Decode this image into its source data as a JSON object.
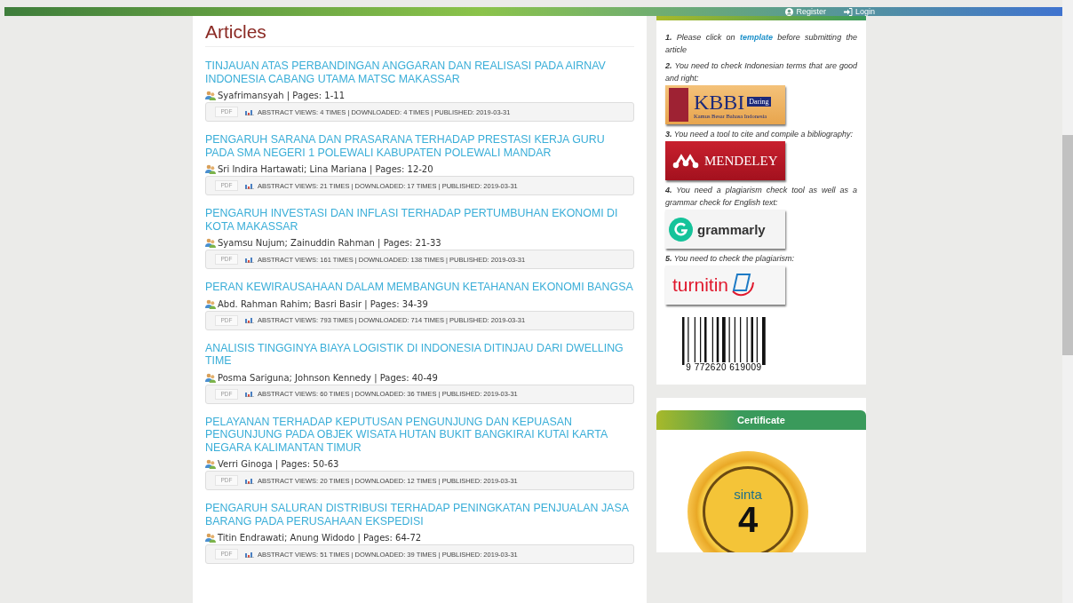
{
  "header": {
    "links": [
      {
        "kind": "user",
        "label": "Register"
      },
      {
        "kind": "login",
        "label": "Login"
      }
    ]
  },
  "articles": {
    "heading": "Articles",
    "items": [
      {
        "title": "TINJAUAN ATAS PERBANDINGAN ANGGARAN DAN REALISASI PADA AIRNAV INDONESIA CABANG UTAMA MATSC MAKASSAR",
        "byline": "Syafrimansyah | Pages: 1-11",
        "pdf": "PDF",
        "stats": "ABSTRACT VIEWS: 4 TIMES | DOWNLOADED: 4 TIMES | PUBLISHED: 2019-03-31"
      },
      {
        "title": "PENGARUH SARANA DAN PRASARANA TERHADAP PRESTASI KERJA GURU PADA SMA NEGERI 1 POLEWALI KABUPATEN POLEWALI MANDAR",
        "byline": "Sri Indira Hartawati; Lina Mariana | Pages: 12-20",
        "pdf": "PDF",
        "stats": "ABSTRACT VIEWS: 21 TIMES | DOWNLOADED: 17 TIMES | PUBLISHED: 2019-03-31"
      },
      {
        "title": "PENGARUH INVESTASI DAN INFLASI TERHADAP PERTUMBUHAN EKONOMI DI KOTA MAKASSAR",
        "byline": "Syamsu Nujum; Zainuddin Rahman | Pages: 21-33",
        "pdf": "PDF",
        "stats": "ABSTRACT VIEWS: 161 TIMES | DOWNLOADED: 138 TIMES | PUBLISHED: 2019-03-31"
      },
      {
        "title": "PERAN KEWIRAUSAHAAN DALAM MEMBANGUN KETAHANAN EKONOMI BANGSA",
        "byline": "Abd. Rahman Rahim; Basri Basir | Pages: 34-39",
        "pdf": "PDF",
        "stats": "ABSTRACT VIEWS: 793 TIMES | DOWNLOADED: 714 TIMES | PUBLISHED: 2019-03-31"
      },
      {
        "title": "ANALISIS TINGGINYA BIAYA LOGISTIK DI INDONESIA DITINJAU DARI DWELLING TIME",
        "byline": "Posma Sariguna; Johnson Kennedy | Pages: 40-49",
        "pdf": "PDF",
        "stats": "ABSTRACT VIEWS: 60 TIMES | DOWNLOADED: 36 TIMES | PUBLISHED: 2019-03-31"
      },
      {
        "title": "PELAYANAN TERHADAP KEPUTUSAN PENGUNJUNG DAN KEPUASAN PENGUNJUNG PADA OBJEK WISATA HUTAN BUKIT BANGKIRAI KUTAI KARTA NEGARA KALIMANTAN TIMUR",
        "byline": "Verri Ginoga | Pages: 50-63",
        "pdf": "PDF",
        "stats": "ABSTRACT VIEWS: 20 TIMES | DOWNLOADED: 12 TIMES | PUBLISHED: 2019-03-31"
      },
      {
        "title": "PENGARUH SALURAN DISTRIBUSI TERHADAP PENINGKATAN PENJUALAN JASA BARANG PADA PERUSAHAAN EKSPEDISI",
        "byline": "Titin Endrawati; Anung Widodo | Pages: 64-72",
        "pdf": "PDF",
        "stats": "ABSTRACT VIEWS: 51 TIMES | DOWNLOADED: 39 TIMES | PUBLISHED: 2019-03-31"
      }
    ]
  },
  "sidebar": {
    "tools": [
      {
        "number": "1.",
        "text": "Please click on",
        "link": "template",
        "text_after": "before submitting the article"
      },
      {
        "number": "2.",
        "text": "You need to check Indonesian terms that are good and right:",
        "logo": {
          "kind": "kbbi",
          "title": "KBBI",
          "badge": "Daring",
          "subtitle": "Kamus Besar Bahasa Indonesia"
        }
      },
      {
        "number": "3.",
        "text": "You need a tool to cite and compile a bibliography:",
        "logo": {
          "kind": "mendeley",
          "title": "MENDELEY"
        }
      },
      {
        "number": "4.",
        "text": "You need a plagiarism check tool as well as a grammar check for English text:",
        "logo": {
          "kind": "grammarly",
          "title": "grammarly"
        }
      },
      {
        "number": "5.",
        "text": "You need to check the plagiarism:",
        "logo": {
          "kind": "turnitin",
          "title": "turnitin"
        }
      }
    ],
    "barcode": "9 772620 619009",
    "certificate": {
      "heading": "Certificate",
      "brand": "sinta",
      "grade": "4"
    }
  }
}
